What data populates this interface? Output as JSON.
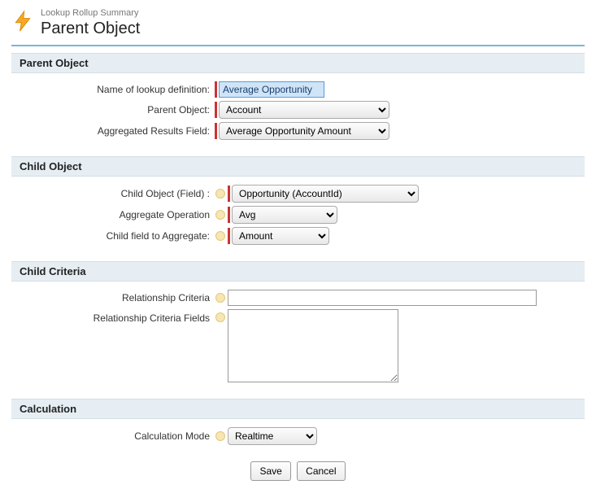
{
  "header": {
    "eyebrow": "Lookup Rollup Summary",
    "title": "Parent Object"
  },
  "sections": {
    "parent": {
      "title": "Parent Object",
      "name_label": "Name of lookup definition:",
      "name_value": "Average Opportunity",
      "parent_object_label": "Parent Object:",
      "parent_object_value": "Account",
      "agg_results_label": "Aggregated Results Field:",
      "agg_results_value": "Average Opportunity Amount"
    },
    "child": {
      "title": "Child Object",
      "child_object_label": "Child Object (Field) :",
      "child_object_value": "Opportunity (AccountId)",
      "agg_op_label": "Aggregate Operation",
      "agg_op_value": "Avg",
      "child_field_label": "Child field to Aggregate:",
      "child_field_value": "Amount"
    },
    "criteria": {
      "title": "Child Criteria",
      "rel_criteria_label": "Relationship Criteria",
      "rel_criteria_value": "",
      "rel_fields_label": "Relationship Criteria Fields",
      "rel_fields_value": ""
    },
    "calc": {
      "title": "Calculation",
      "mode_label": "Calculation Mode",
      "mode_value": "Realtime"
    }
  },
  "buttons": {
    "save": "Save",
    "cancel": "Cancel"
  }
}
